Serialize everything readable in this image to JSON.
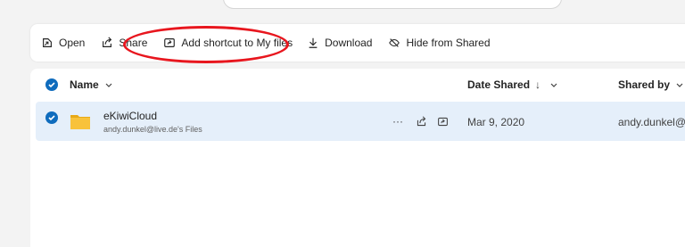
{
  "toolbar": {
    "open_label": "Open",
    "share_label": "Share",
    "add_shortcut_label": "Add shortcut to My files",
    "download_label": "Download",
    "hide_label": "Hide from Shared"
  },
  "columns": {
    "name": "Name",
    "date_shared": "Date Shared",
    "date_sort_arrow": "↓",
    "shared_by": "Shared by"
  },
  "rows": [
    {
      "name": "eKiwiCloud",
      "subtitle": "andy.dunkel@live.de's Files",
      "date": "Mar 9, 2020",
      "shared_by": "andy.dunkel@live.de",
      "more": "···"
    }
  ],
  "colors": {
    "accent": "#0f6cbd",
    "selected_row": "#e5effa",
    "annotation": "#e8161e",
    "folder": "#f8c23b"
  }
}
